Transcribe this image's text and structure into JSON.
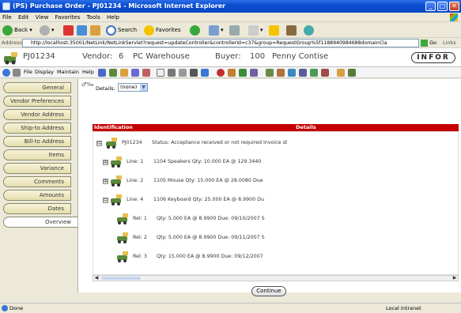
{
  "window": {
    "title": "(PS) Purchase Order - PJ01234 - Microsoft Internet Explorer",
    "min": "_",
    "max": "□",
    "close": "✕"
  },
  "menu": [
    "File",
    "Edit",
    "View",
    "Favorites",
    "Tools",
    "Help"
  ],
  "toolbar": {
    "back": "Back",
    "search": "Search",
    "favorites": "Favorites"
  },
  "address": {
    "label": "Address",
    "url": "http://localhost:35001/NetLink/NetLinkServlet?request=updateController&controllerId=c37&group=RequestGroup%5f1188940984688domainCla",
    "go": "Go",
    "links": "Links"
  },
  "header": {
    "po_number": "PJ01234",
    "vendor_label": "Vendor:",
    "vendor_id": "6",
    "vendor_name": "PC Warehouse",
    "buyer_label": "Buyer:",
    "buyer_id": "100",
    "buyer_name": "Penny Contise",
    "logo_text": "INFOR"
  },
  "app_menu": [
    "File",
    "Display",
    "Maintain",
    "Help"
  ],
  "nav": {
    "tabs": [
      "General",
      "Vendor Preferences",
      "Vendor Address",
      "Ship-to Address",
      "Bill-to Address",
      "Items",
      "Variance",
      "Comments",
      "Amounts",
      "Dates",
      "Overview"
    ],
    "active": "Overview"
  },
  "details": {
    "label": "Details:",
    "value": "(none)"
  },
  "grid": {
    "columns": [
      "Identification",
      "Details"
    ],
    "rows": [
      {
        "exp": "⊟",
        "id": "PJ01234",
        "text": "Status:  Acceptance received or not required    Invoice st"
      },
      {
        "exp": "⊞",
        "id": "Line:  1",
        "text": "1104  Speakers    Qty:  10.000  EA  @  129.3440"
      },
      {
        "exp": "⊞",
        "id": "Line:  2",
        "text": "1105  Mouse     Qty:  15.000  EA  @  28.0080     Due"
      },
      {
        "exp": "⊟",
        "id": "Line:  4",
        "text": "1106  Keyboard    Qty:  25.000  EA  @  8.9900     Du"
      },
      {
        "exp": "",
        "id": "Rel:  1",
        "text": "Qty:  5.000  EA  @  8.9900    Due:  09/10/2007     S"
      },
      {
        "exp": "",
        "id": "Rel:  2",
        "text": "Qty:  5.000  EA  @  8.9900    Due:  09/11/2007     S"
      },
      {
        "exp": "",
        "id": "Rel:  3",
        "text": "Qty:  15.000  EA  @  8.9900    Due:  09/12/2007"
      }
    ]
  },
  "continue_label": "Continue",
  "status": {
    "left": "Done",
    "zone": "Local intranet"
  },
  "colors": {
    "title_bar": "#0a4fd1",
    "grid_header": "#c40000",
    "nav_tab": "#e6dfb0"
  }
}
